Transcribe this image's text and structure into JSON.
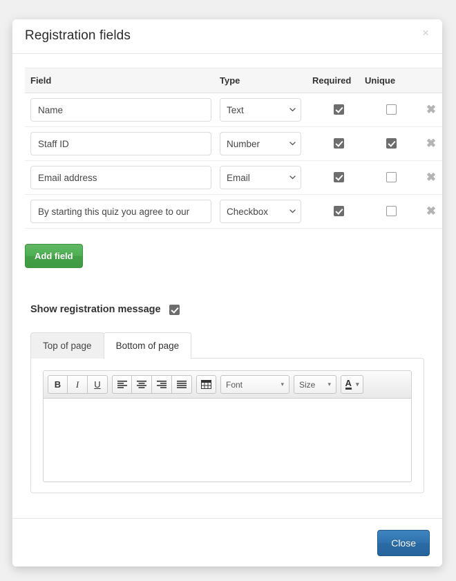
{
  "modal": {
    "title": "Registration fields",
    "close_icon": "close-icon",
    "close_symbol": "×"
  },
  "table": {
    "headers": {
      "field": "Field",
      "type": "Type",
      "required": "Required",
      "unique": "Unique"
    },
    "rows": [
      {
        "field_value": "Name",
        "type_value": "Text",
        "required": true,
        "unique": false,
        "delete_symbol": "✖"
      },
      {
        "field_value": "Staff ID",
        "type_value": "Number",
        "required": true,
        "unique": true,
        "delete_symbol": "✖"
      },
      {
        "field_value": "Email address",
        "type_value": "Email",
        "required": true,
        "unique": false,
        "delete_symbol": "✖"
      },
      {
        "field_value": "By starting this quiz you agree to our",
        "type_value": "Checkbox",
        "required": true,
        "unique": false,
        "delete_symbol": "✖"
      }
    ],
    "type_options": [
      "Text",
      "Number",
      "Email",
      "Checkbox"
    ]
  },
  "actions": {
    "add_field_label": "Add field"
  },
  "registration_message": {
    "label": "Show registration message",
    "checked": true
  },
  "tabs": [
    {
      "label": "Top of page",
      "active": false
    },
    {
      "label": "Bottom of page",
      "active": true
    }
  ],
  "editor": {
    "bold_label": "B",
    "italic_label": "I",
    "underline_label": "U",
    "align_left_icon": "align-left-icon",
    "align_center_icon": "align-center-icon",
    "align_right_icon": "align-right-icon",
    "align_justify_icon": "align-justify-icon",
    "table_icon": "insert-table-icon",
    "font_label": "Font",
    "size_label": "Size",
    "font_color_label": "A",
    "caret_symbol": "▾",
    "content": ""
  },
  "footer": {
    "close_label": "Close"
  },
  "colors": {
    "accent_green": "#4caf50",
    "accent_blue": "#2f72ad",
    "checkbox_checked": "#6d6d6d",
    "delete_icon": "#b4b4b4",
    "header_row_bg": "#f6f6f6"
  }
}
